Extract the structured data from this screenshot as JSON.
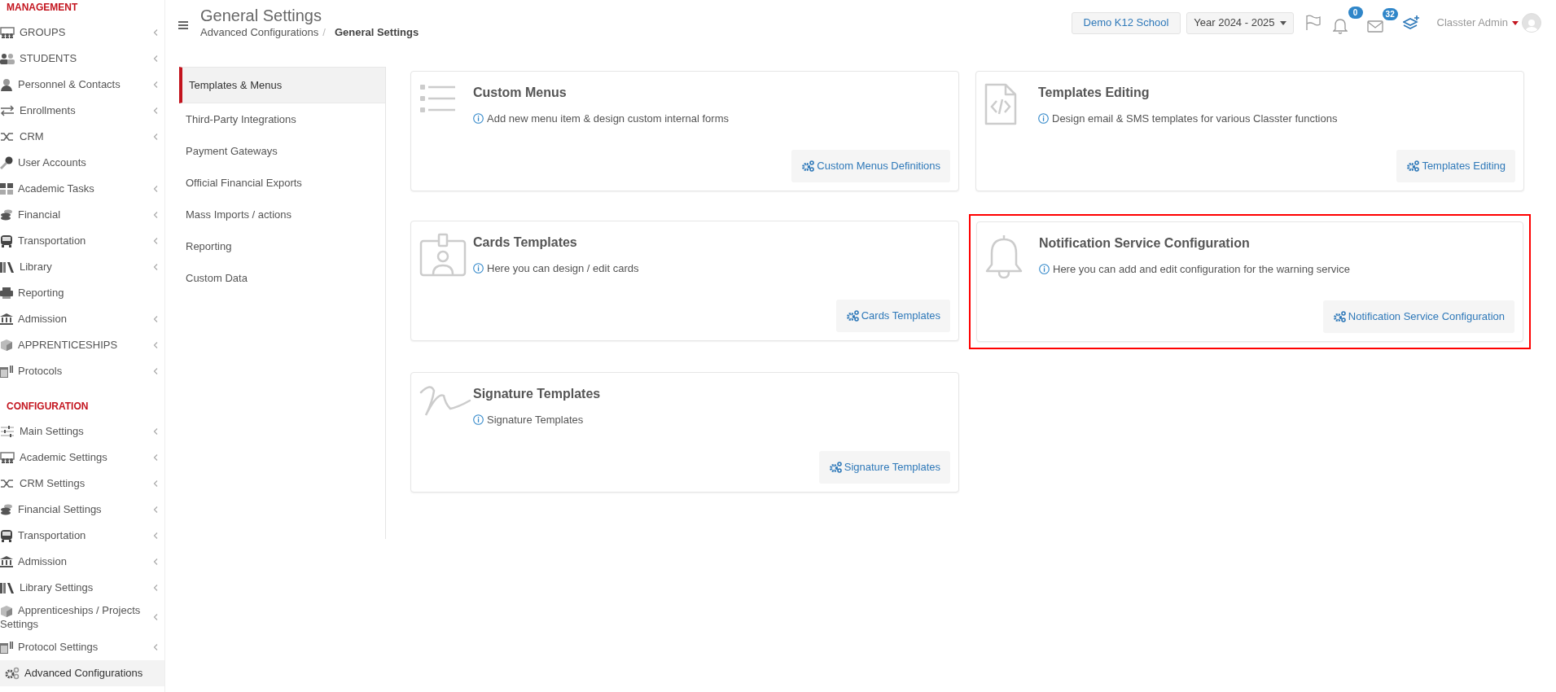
{
  "sidebar": {
    "sections": [
      {
        "title": "MANAGEMENT",
        "items": [
          {
            "label": "GROUPS",
            "expandable": true,
            "selected": false
          },
          {
            "label": "STUDENTS",
            "expandable": true,
            "selected": false
          },
          {
            "label": "Personnel & Contacts",
            "expandable": true,
            "selected": false
          },
          {
            "label": "Enrollments",
            "expandable": true,
            "selected": false
          },
          {
            "label": "CRM",
            "expandable": true,
            "selected": false
          },
          {
            "label": "User Accounts",
            "expandable": false,
            "selected": false
          },
          {
            "label": "Academic Tasks",
            "expandable": true,
            "selected": false
          },
          {
            "label": "Financial",
            "expandable": true,
            "selected": false
          },
          {
            "label": "Transportation",
            "expandable": true,
            "selected": false
          },
          {
            "label": "Library",
            "expandable": true,
            "selected": false
          },
          {
            "label": "Reporting",
            "expandable": false,
            "selected": false
          },
          {
            "label": "Admission",
            "expandable": true,
            "selected": false
          },
          {
            "label": "APPRENTICESHIPS",
            "expandable": true,
            "selected": false
          },
          {
            "label": "Protocols",
            "expandable": true,
            "selected": false
          }
        ]
      },
      {
        "title": "CONFIGURATION",
        "items": [
          {
            "label": "Main Settings",
            "expandable": true,
            "selected": false
          },
          {
            "label": "Academic Settings",
            "expandable": true,
            "selected": false
          },
          {
            "label": "CRM Settings",
            "expandable": true,
            "selected": false
          },
          {
            "label": "Financial Settings",
            "expandable": true,
            "selected": false
          },
          {
            "label": "Transportation",
            "expandable": true,
            "selected": false
          },
          {
            "label": "Admission",
            "expandable": true,
            "selected": false
          },
          {
            "label": "Library Settings",
            "expandable": true,
            "selected": false
          },
          {
            "label": "Apprenticeships / Projects Settings",
            "expandable": true,
            "selected": false
          },
          {
            "label": "Protocol Settings",
            "expandable": true,
            "selected": false
          },
          {
            "label": "Advanced Configurations",
            "expandable": false,
            "selected": true
          }
        ]
      }
    ]
  },
  "header": {
    "title": "General Settings",
    "breadcrumb": [
      "Advanced Configurations",
      "General Settings"
    ],
    "breadcrumb_separator": "/",
    "school": "Demo K12 School",
    "year": "Year 2024 - 2025",
    "notifications_count": "0",
    "messages_count": "32",
    "user": "Classter Admin"
  },
  "subnav": [
    {
      "label": "Templates & Menus",
      "selected": true
    },
    {
      "label": "Third-Party Integrations",
      "selected": false
    },
    {
      "label": "Payment Gateways",
      "selected": false
    },
    {
      "label": "Official Financial Exports",
      "selected": false
    },
    {
      "label": "Mass Imports / actions",
      "selected": false
    },
    {
      "label": "Reporting",
      "selected": false
    },
    {
      "label": "Custom Data",
      "selected": false
    }
  ],
  "cards": [
    {
      "kind": "list",
      "title": "Custom Menus",
      "description": "Add new menu item & design custom internal forms",
      "button": "Custom Menus Definitions",
      "highlighted": false
    },
    {
      "kind": "code",
      "title": "Templates Editing",
      "description": "Design email & SMS templates for various Classter functions",
      "button": "Templates Editing",
      "highlighted": false
    },
    {
      "kind": "idcard",
      "title": "Cards Templates",
      "description": "Here you can design / edit cards",
      "button": "Cards Templates",
      "highlighted": false
    },
    {
      "kind": "bell",
      "title": "Notification Service Configuration",
      "description": "Here you can add and edit configuration for the warning service",
      "button": "Notification Service Configuration",
      "highlighted": true
    },
    {
      "kind": "signature",
      "title": "Signature Templates",
      "description": "Signature Templates",
      "button": "Signature Templates",
      "highlighted": false
    }
  ]
}
